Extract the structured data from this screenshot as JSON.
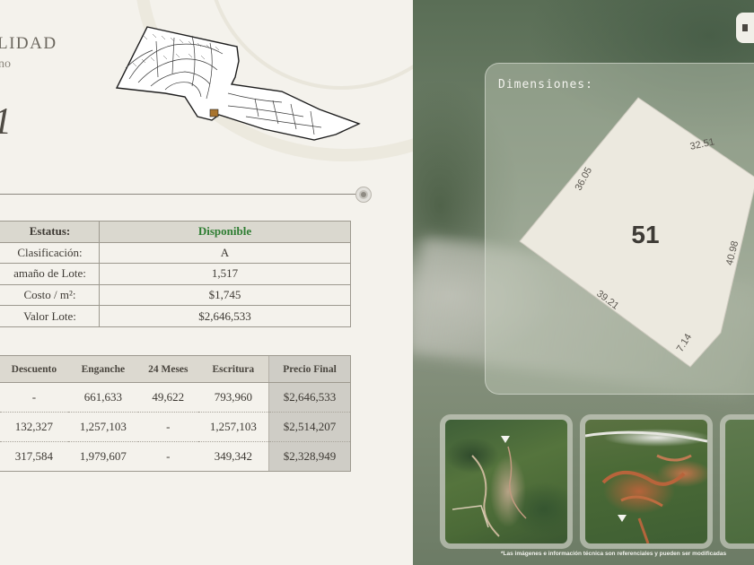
{
  "header": {
    "title": "LIDAD",
    "subtitle": "no",
    "lot_number": "1"
  },
  "status_table": [
    {
      "label": "Estatus:",
      "value": "Disponible"
    },
    {
      "label": "Clasificación:",
      "value": "A"
    },
    {
      "label": "amaño de Lote:",
      "value": "1,517"
    },
    {
      "label": "Costo / m²:",
      "value": "$1,745"
    },
    {
      "label": "Valor Lote:",
      "value": "$2,646,533"
    }
  ],
  "plans_table": {
    "headers": [
      "",
      "Descuento",
      "Enganche",
      "24 Meses",
      "Escritura",
      "Precio Final"
    ],
    "rows": [
      [
        "",
        "-",
        "661,633",
        "49,622",
        "793,960",
        "$2,646,533"
      ],
      [
        "",
        "132,327",
        "1,257,103",
        "-",
        "1,257,103",
        "$2,514,207"
      ],
      [
        "",
        "317,584",
        "1,979,607",
        "-",
        "349,342",
        "$2,328,949"
      ]
    ]
  },
  "dimensions": {
    "title": "Dimensiones:",
    "lot_label": "51",
    "sides": [
      "36.05",
      "32.51",
      "40.98",
      "7.14",
      "39.21"
    ]
  },
  "disclaimer": "*Las imágenes e información técnica son referenciales y pueden ser modificadas",
  "colors": {
    "available": "#2e7d32",
    "table_header": "#dad8cf",
    "final_price_bg": "#cfcdc6",
    "panel_bg": "#f4f2ec"
  },
  "icons": {
    "slider": "slider-dot-icon",
    "corner": "corner-button-icon"
  }
}
